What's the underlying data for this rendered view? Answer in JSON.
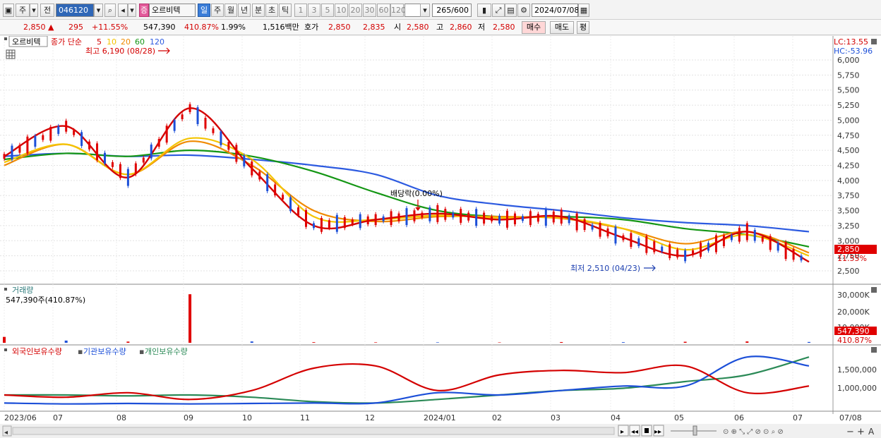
{
  "toolbar": {
    "market_label": "주",
    "prev_label": "전",
    "code": "046120",
    "stock_name": "오르비텍",
    "name_badge": "증",
    "periods": [
      "일",
      "주",
      "월",
      "년",
      "분",
      "초",
      "틱"
    ],
    "intervals": [
      "1",
      "3",
      "5",
      "10",
      "20",
      "30",
      "60",
      "120"
    ],
    "count_value": "265",
    "count_total": "/600",
    "date_value": "2024/07/08"
  },
  "quote": {
    "price": "2,850",
    "arrow": "▲",
    "change": "295",
    "change_pct": "+11.55%",
    "volume": "547,390",
    "volume_ratio": "410.87%",
    "turnover": "1.99%",
    "amount": "1,516백만",
    "bid_label": "호가",
    "bid": "2,850",
    "ask": "2,835",
    "open_label": "시",
    "open": "2,580",
    "high_label": "고",
    "high": "2,860",
    "low_label": "저",
    "low": "2,580",
    "buy_label": "매수",
    "sell_label": "매도",
    "eval_label": "평"
  },
  "price_panel": {
    "legend_name": "오르비텍",
    "legend_ma": "종가 단순",
    "ma_periods": [
      {
        "label": "5",
        "color": "#d40000"
      },
      {
        "label": "10",
        "color": "#f4c400"
      },
      {
        "label": "20",
        "color": "#f08a00"
      },
      {
        "label": "60",
        "color": "#149614"
      },
      {
        "label": "120",
        "color": "#2c5ae0"
      }
    ],
    "max_annotation": "최고 6,190 (08/28)",
    "min_annotation": "최저 2,510 (04/23)",
    "dividend_annotation": "배당락(0.00%)",
    "lc_label": "LC:13.55",
    "hc_label": "HC:-53.96",
    "y_ticks": [
      "6,000",
      "5,750",
      "5,500",
      "5,250",
      "5,000",
      "4,750",
      "4,500",
      "4,250",
      "4,000",
      "3,750",
      "3,500",
      "3,250",
      "3,000",
      "2,750",
      "2,500"
    ],
    "last_price_tag": "2,850",
    "last_pct_tag": "11.55%"
  },
  "volume_panel": {
    "title": "거래량",
    "value_text": "547,390주(410.87%)",
    "y_ticks": [
      "30,000K",
      "20,000K",
      "10,000K"
    ],
    "last_tag": "547,390",
    "last_pct_tag": "410.87%"
  },
  "holdings_panel": {
    "series": [
      {
        "name": "외국인보유수량",
        "color": "#d40000"
      },
      {
        "name": "기관보유수량",
        "color": "#1c4fd8"
      },
      {
        "name": "개인보유수량",
        "color": "#2b8a57"
      }
    ],
    "y_ticks": [
      "1,500,000",
      "1,000,000"
    ]
  },
  "x_axis": {
    "labels": [
      "2023/06",
      "07",
      "08",
      "09",
      "10",
      "11",
      "12",
      "2024/01",
      "02",
      "03",
      "04",
      "05",
      "06",
      "07",
      "07/08"
    ]
  },
  "chart_data": [
    {
      "type": "line",
      "title": "",
      "xlabel": "",
      "ylabel": "",
      "ylim": [
        2400,
        6200
      ],
      "x": [
        "2023/06",
        "07",
        "08",
        "09",
        "10",
        "11",
        "12",
        "2024/01",
        "02",
        "03",
        "04",
        "05",
        "06",
        "07"
      ],
      "series": [
        {
          "name": "5",
          "values": [
            4400,
            4900,
            4050,
            5200,
            4200,
            3250,
            3350,
            3450,
            3350,
            3400,
            3050,
            2750,
            3150,
            2650
          ]
        },
        {
          "name": "10",
          "values": [
            4300,
            4600,
            4100,
            4700,
            4350,
            3400,
            3350,
            3420,
            3380,
            3380,
            3200,
            2850,
            3100,
            2750
          ]
        },
        {
          "name": "20",
          "values": [
            4250,
            4600,
            4100,
            4650,
            4250,
            3500,
            3320,
            3400,
            3400,
            3370,
            3200,
            2950,
            3150,
            2800
          ]
        },
        {
          "name": "60",
          "values": [
            4350,
            4450,
            4400,
            4500,
            4400,
            4150,
            3800,
            3500,
            3400,
            3400,
            3350,
            3200,
            3100,
            2900
          ]
        },
        {
          "name": "120",
          "values": [
            4400,
            4450,
            4400,
            4420,
            4350,
            4250,
            4100,
            3750,
            3600,
            3500,
            3380,
            3300,
            3250,
            3150
          ]
        }
      ]
    },
    {
      "type": "bar",
      "title": "",
      "xlabel": "",
      "ylabel": "",
      "ylim": [
        0,
        35000
      ],
      "x": [
        "2023/06",
        "07",
        "08",
        "09",
        "10",
        "11",
        "12",
        "2024/01",
        "02",
        "03",
        "04",
        "05",
        "06",
        "07"
      ],
      "values": [
        4000,
        1500,
        800,
        33000,
        900,
        400,
        300,
        300,
        250,
        500,
        400,
        700,
        900,
        547
      ]
    },
    {
      "type": "line",
      "title": "",
      "xlabel": "",
      "ylabel": "",
      "ylim": [
        700000,
        1900000
      ],
      "x": [
        "2023/06",
        "07",
        "08",
        "09",
        "10",
        "11",
        "12",
        "2024/01",
        "02",
        "03",
        "04",
        "05",
        "06",
        "07"
      ],
      "series": [
        {
          "name": "외국인보유수량",
          "values": [
            1000000,
            950000,
            1050000,
            900000,
            1100000,
            1600000,
            1650000,
            1100000,
            1450000,
            1550000,
            1500000,
            1650000,
            1050000,
            1200000
          ]
        },
        {
          "name": "기관보유수량",
          "values": [
            820000,
            800000,
            810000,
            800000,
            810000,
            820000,
            820000,
            1050000,
            1000000,
            1100000,
            1200000,
            1200000,
            1850000,
            1650000
          ]
        },
        {
          "name": "개인보유수량",
          "values": [
            1000000,
            1000000,
            980000,
            1000000,
            950000,
            850000,
            820000,
            900000,
            1000000,
            1100000,
            1150000,
            1300000,
            1450000,
            1850000
          ]
        }
      ]
    }
  ]
}
